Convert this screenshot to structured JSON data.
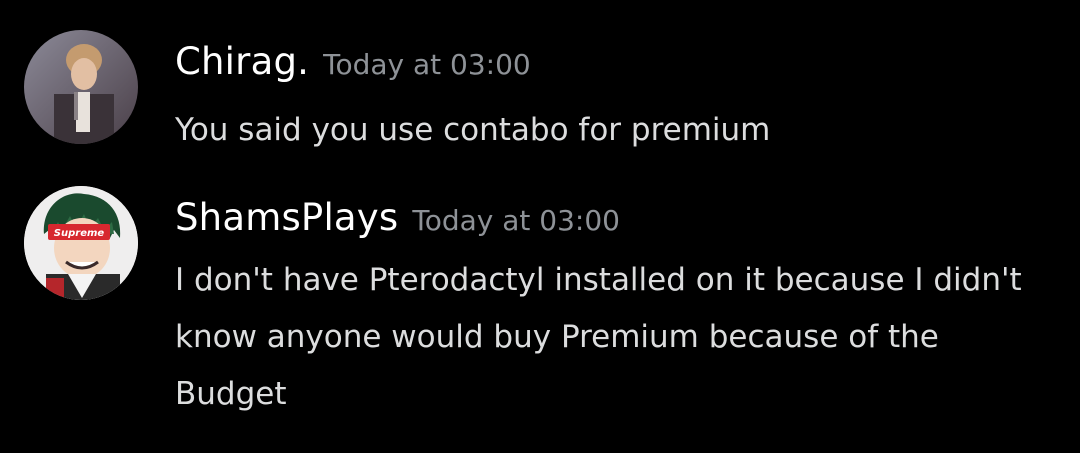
{
  "messages": [
    {
      "username": "Chirag.",
      "timestamp": "Today at 03:00",
      "text": "You said you use contabo for premium",
      "avatar_icon": "user-avatar-icon"
    },
    {
      "username": "ShamsPlays",
      "timestamp": "Today at 03:00",
      "text": "I don't have Pterodactyl installed on it because I didn't know anyone would buy Premium because of the Budget",
      "avatar_icon": "user-avatar-icon",
      "avatar_text": "Supreme"
    }
  ],
  "colors": {
    "background": "#000000",
    "username": "#ffffff",
    "timestamp": "#8e9297",
    "message_text": "#dcddde",
    "supreme_red": "#d7282f"
  }
}
